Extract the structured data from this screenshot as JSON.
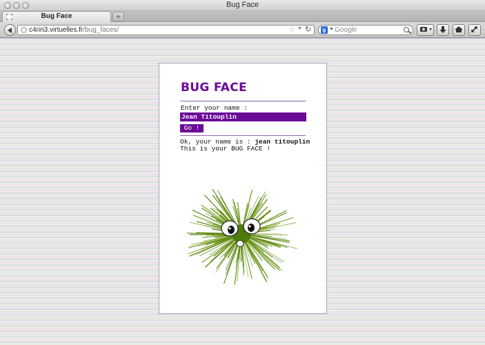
{
  "window": {
    "title": "Bug Face"
  },
  "tabs": [
    {
      "label": "Bug Face"
    }
  ],
  "navbar": {
    "url_domain": "c4rin3.virtuelles.fr",
    "url_path": "/bug_faces/",
    "search_placeholder": "Google",
    "new_tab_label": "+"
  },
  "page": {
    "heading": "BUG FACE",
    "name_prompt": "Enter your name :",
    "name_value": "Jean Titouplin",
    "go_label": "Go !",
    "result_prefix": "Ok, your name is : ",
    "result_name": "jean titouplin",
    "result_line2": "This is your BUG FACE !"
  },
  "colors": {
    "accent": "#6a0a98",
    "bug_green": "#5d8a12"
  }
}
